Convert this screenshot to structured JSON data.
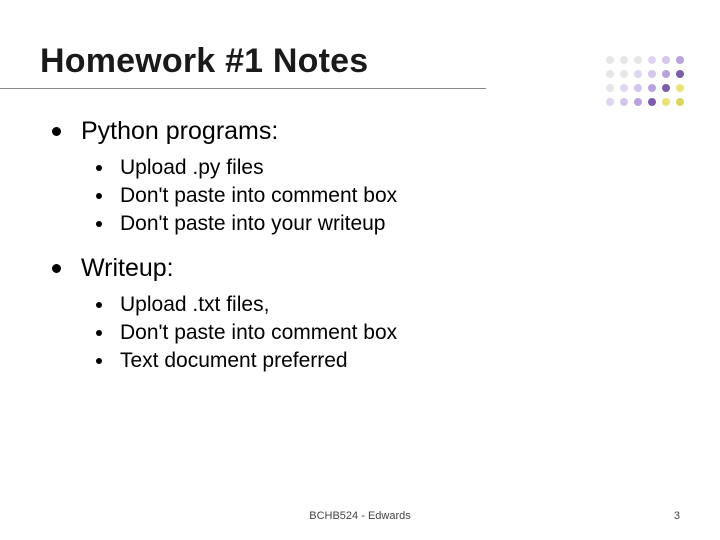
{
  "title": "Homework #1 Notes",
  "sections": [
    {
      "heading": "Python programs:",
      "items": [
        "Upload .py files",
        "Don't paste into comment box",
        "Don't paste into your writeup"
      ]
    },
    {
      "heading": "Writeup:",
      "items": [
        "Upload .txt files,",
        "Don't paste into comment box",
        "Text document preferred"
      ]
    }
  ],
  "footer": {
    "center": "BCHB524 - Edwards",
    "page": "3"
  },
  "decoration": {
    "dot_colors": [
      "#e6e6e6",
      "#e6e6e6",
      "#e6e6e6",
      "#ded6f0",
      "#d4c7ea",
      "#b9a3dc",
      "#e6e6e6",
      "#e6e6e6",
      "#ded6f0",
      "#d4c7ea",
      "#b9a3dc",
      "#7c5ea8",
      "#e6e6e6",
      "#ded6f0",
      "#d4c7ea",
      "#b9a3dc",
      "#7c5ea8",
      "#e8e47a",
      "#ded6f0",
      "#d4c7ea",
      "#b9a3dc",
      "#7c5ea8",
      "#e8e47a",
      "#dbd65e"
    ]
  }
}
